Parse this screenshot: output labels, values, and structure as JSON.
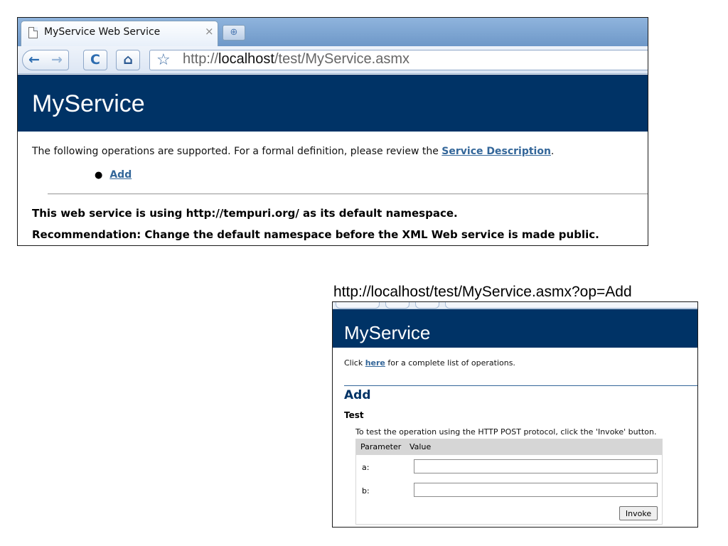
{
  "browser": {
    "tab_title": "MyService Web Service",
    "tab_close": "×",
    "new_tab": "⊕",
    "back": "←",
    "forward": "→",
    "reload": "C",
    "home": "⌂",
    "bookmark": "☆",
    "url_prefix": "http://",
    "url_host": "localhost",
    "url_path": "/test/MyService.asmx"
  },
  "page1": {
    "service_name": "MyService",
    "intro_text": "The following operations are supported. For a formal definition, please review the ",
    "service_description_link": "Service Description",
    "intro_end": ".",
    "operations": [
      "Add"
    ],
    "namespace_note": "This web service is using http://tempuri.org/ as its default namespace.",
    "recommendation": "Recommendation: Change the default namespace before the XML Web service is made public."
  },
  "page2": {
    "caption_url": "http://localhost/test/MyService.asmx?op=Add",
    "service_name": "MyService",
    "click_prefix": "Click ",
    "here_link": "here",
    "click_suffix": " for a complete list of operations.",
    "operation_name": "Add",
    "test_heading": "Test",
    "test_description": "To test the operation using the HTTP POST protocol, click the 'Invoke' button.",
    "table_headers": [
      "Parameter",
      "Value"
    ],
    "parameters": [
      {
        "label": "a:",
        "value": ""
      },
      {
        "label": "b:",
        "value": ""
      }
    ],
    "invoke_label": "Invoke"
  },
  "colors": {
    "header_bg": "#003366",
    "link": "#336699"
  }
}
